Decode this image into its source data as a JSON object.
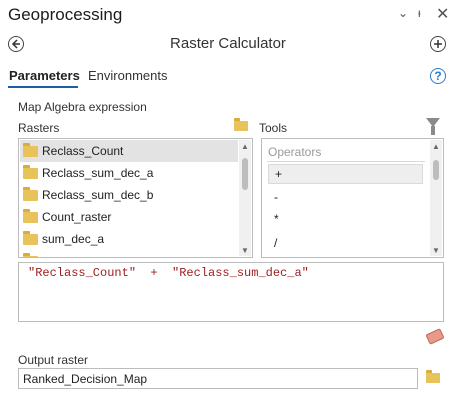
{
  "pane": {
    "title": "Geoprocessing",
    "controls": {
      "menu": "⌄",
      "pin": "ᵻ",
      "close": "✕"
    }
  },
  "tool": {
    "title": "Raster Calculator",
    "back_icon": "back-arrow-icon",
    "add_icon": "plus-icon"
  },
  "tabs": [
    {
      "label": "Parameters",
      "active": true
    },
    {
      "label": "Environments",
      "active": false
    }
  ],
  "help": "?",
  "map_algebra": {
    "label": "Map Algebra expression",
    "rasters_label": "Rasters",
    "tools_label": "Tools",
    "rasters": [
      {
        "name": "Reclass_Count",
        "selected": true
      },
      {
        "name": "Reclass_sum_dec_a",
        "selected": false
      },
      {
        "name": "Reclass_sum_dec_b",
        "selected": false
      },
      {
        "name": "Count_raster",
        "selected": false
      },
      {
        "name": "sum_dec_a",
        "selected": false
      },
      {
        "name": "...",
        "selected": false
      }
    ],
    "operators_header": "Operators",
    "operators": [
      {
        "symbol": "+",
        "selected": true
      },
      {
        "symbol": "-",
        "selected": false
      },
      {
        "symbol": "*",
        "selected": false
      },
      {
        "symbol": "/",
        "selected": false
      }
    ],
    "expression": "\"Reclass_Count\"  +  \"Reclass_sum_dec_a\""
  },
  "output": {
    "label": "Output raster",
    "value": "Ranked_Decision_Map"
  },
  "colors": {
    "accent": "#1b5fa8",
    "help": "#2a7ad0",
    "expression_text": "#9b1c1c",
    "folder": "#e8c25a"
  }
}
